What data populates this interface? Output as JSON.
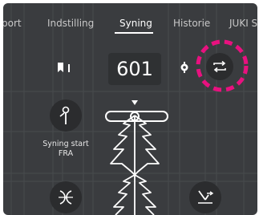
{
  "tabs": [
    {
      "label": "port",
      "active": false
    },
    {
      "label": "Indstilling",
      "active": false
    },
    {
      "label": "Syning",
      "active": true
    },
    {
      "label": "Historie",
      "active": false
    },
    {
      "label": "JUKI S",
      "active": false
    }
  ],
  "counter": {
    "value": "601"
  },
  "start": {
    "label_line1": "Syning start",
    "label_line2": "FRA"
  },
  "icons": {
    "left": "page-marker-icon",
    "settings": "gear-icon",
    "swap": "swap-arrows-icon",
    "needle": "needle-icon",
    "stitch": "stitch-pattern-icon",
    "trim": "trim-icon"
  },
  "colors": {
    "background": "#3a3c3f",
    "button": "#2b2c2e",
    "highlight": "#e8117f",
    "text": "#ffffff"
  }
}
